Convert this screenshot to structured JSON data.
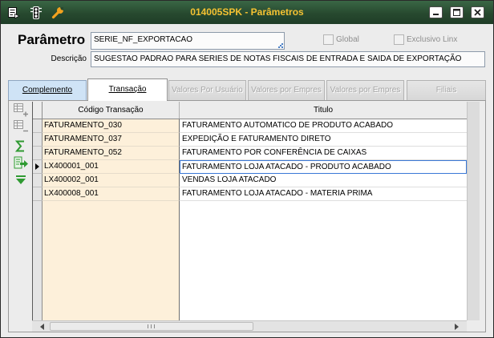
{
  "window": {
    "title": "014005SPK - Parâmetros",
    "left_icons": [
      "notes-icon",
      "traffic-light-icon",
      "wrench-icon"
    ],
    "controls": [
      "minimize-icon",
      "maximize-icon",
      "close-icon"
    ]
  },
  "colors": {
    "titlebar": "#27492f",
    "titlebar_highlight": "#3a6745",
    "title_text": "#f5c232",
    "tab_highlight": "#cfe3f6",
    "code_column": "#fdf0da",
    "focus_border": "#3a78d6",
    "toolbar_icon_enabled": "#2f9a32",
    "toolbar_icon_disabled": "#9a9a9a"
  },
  "form": {
    "parametro_label": "Parâmetro",
    "parametro_value": "SERIE_NF_EXPORTACAO",
    "global": {
      "label": "Global",
      "checked": false,
      "enabled": false
    },
    "exclusivo": {
      "label": "Exclusivo Linx",
      "checked": false,
      "enabled": false
    },
    "descricao_label": "Descrição",
    "descricao_value": "SUGESTAO PADRAO PARA SERIES DE NOTAS FISCAIS DE ENTRADA E SAIDA DE EXPORTAÇÃO"
  },
  "tabs": [
    {
      "label": "Complemento",
      "selected": false,
      "enabled": true
    },
    {
      "label": "Transação",
      "selected": true,
      "enabled": true
    },
    {
      "label": "Valores Por Usuário",
      "selected": false,
      "enabled": false
    },
    {
      "label": "Valores por Empres",
      "selected": false,
      "enabled": false
    },
    {
      "label": "Valores por Empres",
      "selected": false,
      "enabled": false
    },
    {
      "label": "Filiais",
      "selected": false,
      "enabled": false
    }
  ],
  "toolbar": [
    {
      "icon": "add-row-icon",
      "enabled": false
    },
    {
      "icon": "remove-row-icon",
      "enabled": false
    },
    {
      "icon": "sigma-icon",
      "enabled": true
    },
    {
      "icon": "export-icon",
      "enabled": true
    },
    {
      "icon": "move-down-icon",
      "enabled": true
    }
  ],
  "grid": {
    "columns": [
      "Código Transação",
      "Titulo"
    ],
    "rows": [
      {
        "code": "FATURAMENTO_030",
        "title": "FATURAMENTO AUTOMATICO DE PRODUTO ACABADO",
        "selected": false
      },
      {
        "code": "FATURAMENTO_037",
        "title": "EXPEDIÇÃO E FATURAMENTO DIRETO",
        "selected": false
      },
      {
        "code": "FATURAMENTO_052",
        "title": "FATURAMENTO POR CONFERÊNCIA DE CAIXAS",
        "selected": false
      },
      {
        "code": "LX400001_001",
        "title": "FATURAMENTO LOJA ATACADO - PRODUTO ACABADO",
        "selected": true
      },
      {
        "code": "LX400002_001",
        "title": "VENDAS LOJA ATACADO",
        "selected": false
      },
      {
        "code": "LX400008_001",
        "title": "FATURAMENTO LOJA ATACADO - MATERIA PRIMA",
        "selected": false
      }
    ]
  }
}
